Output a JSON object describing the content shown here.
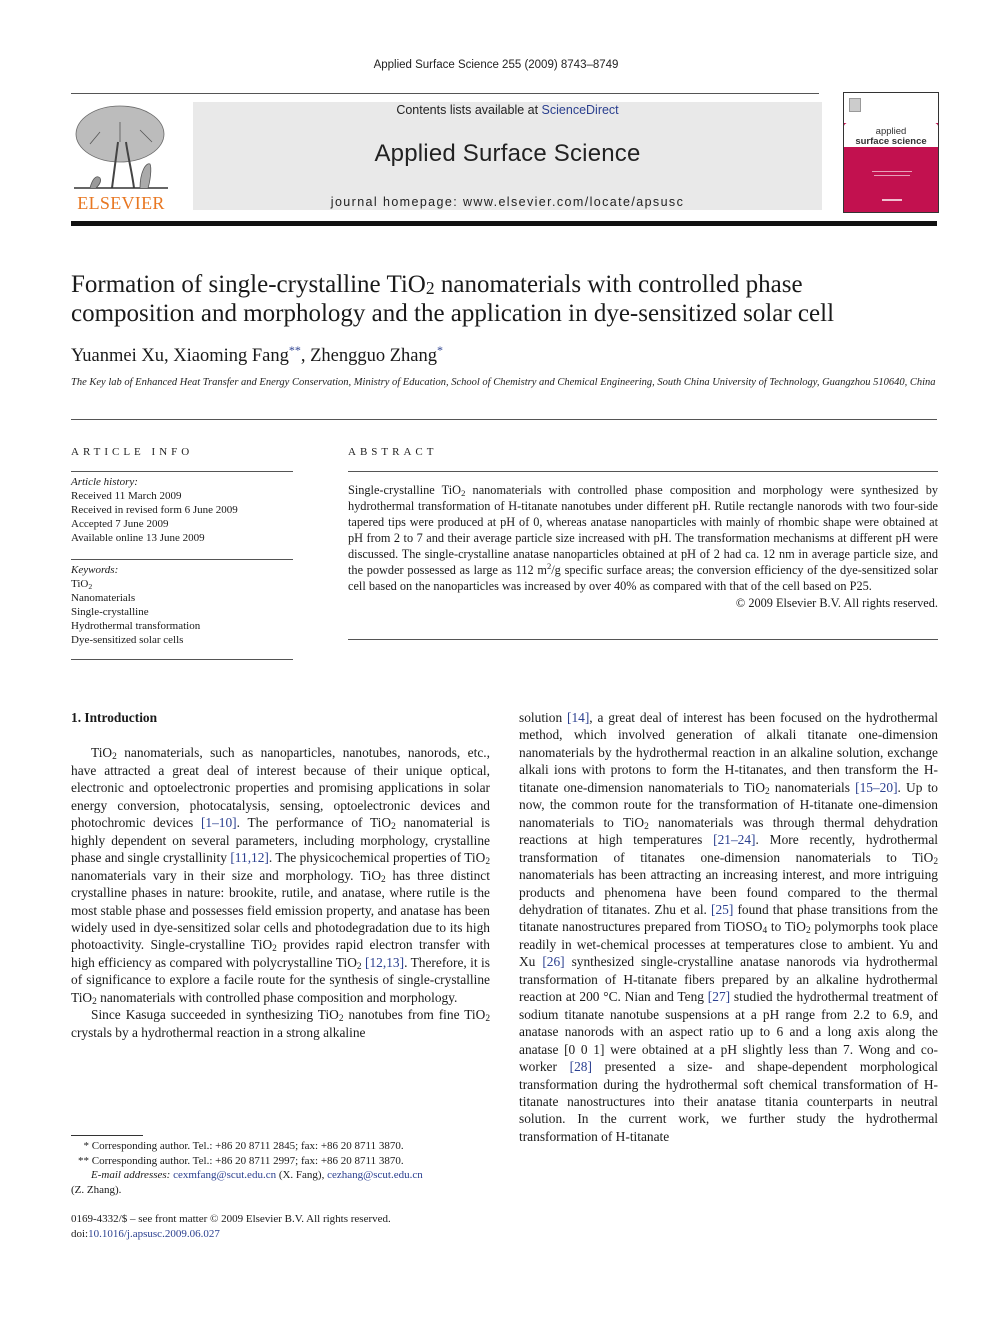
{
  "header": {
    "running_head": "Applied Surface Science 255 (2009) 8743–8749",
    "contents_prefix": "Contents lists available at ",
    "contents_link": "ScienceDirect",
    "journal_name": "Applied Surface Science",
    "homepage": "journal homepage: www.elsevier.com/locate/apsusc",
    "publisher_logo_text": "ELSEVIER",
    "cover_title_line1": "applied",
    "cover_title_line2": "surface science"
  },
  "colors": {
    "link": "#2a3f8f",
    "elsevier_orange": "#e87722",
    "cover_magenta": "#c2114f",
    "masthead_gray": "#e9e9e9"
  },
  "article": {
    "title_line1_a": "Formation of single-crystalline TiO",
    "title_line1_sub": "2",
    "title_line1_b": " nanomaterials with controlled phase",
    "title_line2": "composition and morphology and the application in dye-sensitized solar cell",
    "authors": [
      {
        "name": "Yuanmei Xu",
        "mark": "",
        "sep": ", "
      },
      {
        "name": "Xiaoming Fang",
        "mark": "**",
        "sep": ", "
      },
      {
        "name": "Zhengguo Zhang",
        "mark": "*",
        "sep": ""
      }
    ],
    "affiliation": "The Key lab of Enhanced Heat Transfer and Energy Conservation, Ministry of Education, School of Chemistry and Chemical Engineering, South China University of Technology, Guangzhou 510640, China"
  },
  "article_info": {
    "heading": "ARTICLE INFO",
    "history_label": "Article history:",
    "history": [
      "Received 11 March 2009",
      "Received in revised form 6 June 2009",
      "Accepted 7 June 2009",
      "Available online 13 June 2009"
    ],
    "keywords_label": "Keywords:",
    "keyword_tio2_a": "TiO",
    "keyword_tio2_sub": "2",
    "keywords": [
      "Nanomaterials",
      "Single-crystalline",
      "Hydrothermal transformation",
      "Dye-sensitized solar cells"
    ]
  },
  "abstract": {
    "heading": "ABSTRACT",
    "p1": "Single-crystalline TiO",
    "p1_sub": "2",
    "p2": " nanomaterials with controlled phase composition and morphology were synthesized by hydrothermal transformation of H-titanate nanotubes under different pH. Rutile rectangle nanorods with two four-side tapered tips were produced at pH of 0, whereas anatase nanoparticles with mainly of rhombic shape were obtained at pH from 2 to 7 and their average particle size increased with pH. The transformation mechanisms at different pH were discussed. The single-crystalline anatase nanoparticles obtained at pH of 2 had ca. 12 nm in average particle size, and the powder possessed as large as 112 m",
    "p2_sup": "2",
    "p3": "/g specific surface areas; the conversion efficiency of the dye-sensitized solar cell based on the nanoparticles was increased by over 40% as compared with that of the cell based on P25.",
    "copyright": "© 2009 Elsevier B.V. All rights reserved."
  },
  "body": {
    "section_heading": "1.  Introduction",
    "left": {
      "s1": "TiO",
      "s2": " nanomaterials, such as nanoparticles, nanotubes, nanorods, etc., have attracted a great deal of interest because of their unique optical, electronic and optoelectronic properties and promising applications in solar energy conversion, photocatalysis, sensing, optoelectronic devices and photochromic devices ",
      "r1": "[1–10]",
      "s3": ". The performance of TiO",
      "s4": " nanomaterial is highly dependent on several parameters, including morphology, crystalline phase and single crystallinity ",
      "r2": "[11,12]",
      "s5": ". The physicochemical properties of TiO",
      "s6": " nanomaterials vary in their size and morphology. TiO",
      "s7": " has three distinct crystalline phases in nature: brookite, rutile, and anatase, where rutile is the most stable phase and possesses field emission property, and anatase has been widely used in dye-sensitized solar cells and photodegradation due to its high photoactivity. Single-crystalline TiO",
      "s8": " provides rapid electron transfer with high efficiency as compared with polycrystalline TiO",
      "s9": " ",
      "r3": "[12,13]",
      "s10": ". Therefore, it is of significance to explore a facile route for the synthesis of single-crystalline TiO",
      "s11": " nanomaterials with controlled phase composition and morphology.",
      "p2a": "Since Kasuga succeeded in synthesizing TiO",
      "p2b": " nanotubes from fine TiO",
      "p2c": " crystals by a hydrothermal reaction in a strong alkaline",
      "sub2": "2"
    },
    "right": {
      "s1": "solution ",
      "r1": "[14]",
      "s2": ", a great deal of interest has been focused on the hydrothermal method, which involved generation of alkali titanate one-dimension nanomaterials by the hydrothermal reaction in an alkaline solution, exchange alkali ions with protons to form the H-titanates, and then transform the H-titanate one-dimension nanomaterials to TiO",
      "s3": " nanomaterials ",
      "r2": "[15–20]",
      "s4": ". Up to now, the common route for the transformation of H-titanate one-dimension nanomaterials to TiO",
      "s5": " nanomaterials was through thermal dehydration reactions at high temperatures ",
      "r3": "[21–24]",
      "s6": ". More recently, hydrothermal transformation of titanates one-dimension nanomaterials to TiO",
      "s7": " nanomaterials has been attracting an increasing interest, and more intriguing products and phenomena have been found compared to the thermal dehydration of titanates. Zhu et al. ",
      "r4": "[25]",
      "s8": " found that phase transitions from the titanate nanostructures prepared from TiOSO",
      "sub4": "4",
      "s9": " to TiO",
      "s10": " polymorphs took place readily in wet-chemical processes at temperatures close to ambient. Yu and Xu ",
      "r5": "[26]",
      "s11": " synthesized single-crystalline anatase nanorods via hydrothermal transformation of H-titanate fibers prepared by an alkaline hydrothermal reaction at 200 °C. Nian and Teng ",
      "r6": "[27]",
      "s12": " studied the hydrothermal treatment of sodium titanate nanotube suspensions at a pH range from 2.2 to 6.9, and anatase nanorods with an aspect ratio up to 6 and a long axis along the anatase [0 0 1] were obtained at a pH slightly less than 7. Wong and co-worker ",
      "r7": "[28]",
      "s13": " presented a size- and shape-dependent morphological transformation during the hydrothermal soft chemical transformation of H-titanate nanostructures into their anatase titania counterparts in neutral solution. In the current work, we further study the hydrothermal transformation of H-titanate",
      "sub2": "2"
    }
  },
  "footnotes": {
    "fn1_mark": "*",
    "fn1": "Corresponding author. Tel.: +86 20 8711 2845; fax: +86 20 8711 3870.",
    "fn2_mark": "**",
    "fn2": "Corresponding author. Tel.: +86 20 8711 2997; fax: +86 20 8711 3870.",
    "email_label": "E-mail addresses:",
    "email1": "cexmfang@scut.edu.cn",
    "email1_owner": " (X. Fang), ",
    "email2": "cezhang@scut.edu.cn",
    "email2_owner": "(Z. Zhang).",
    "issn": "0169-4332/$ – see front matter © 2009 Elsevier B.V. All rights reserved.",
    "doi_label": "doi:",
    "doi": "10.1016/j.apsusc.2009.06.027"
  }
}
